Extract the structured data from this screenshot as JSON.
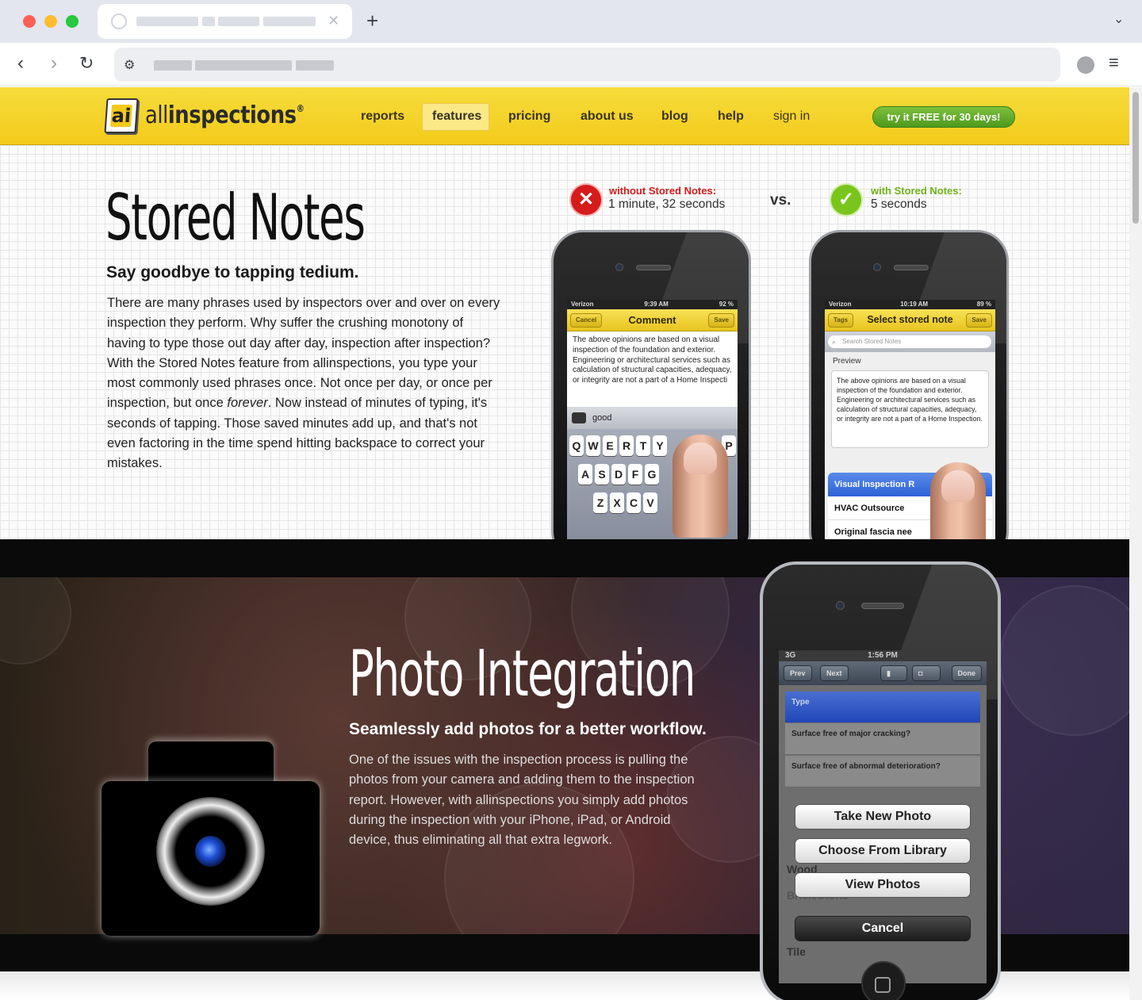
{
  "site": {
    "logo": {
      "mark": "ai",
      "light": "all",
      "bold": "inspections",
      "reg": "®"
    },
    "nav": [
      {
        "label": "reports"
      },
      {
        "label": "features"
      },
      {
        "label": "pricing"
      },
      {
        "label": "about us"
      },
      {
        "label": "blog"
      },
      {
        "label": "help"
      },
      {
        "label": "sign in"
      }
    ],
    "active_nav": "features",
    "cta": "try it FREE for 30 days!"
  },
  "stored_notes": {
    "title": "Stored Notes",
    "subtitle": "Say goodbye to tapping tedium.",
    "body_before": "There are many phrases used by inspectors over and over on every inspection they perform. Why suffer the crushing monotony of having to type those out day after day, inspection after inspection? With the Stored Notes feature from allinspections, you type your most commonly used phrases once. Not once per day, or once per inspection, but once ",
    "body_em": "forever",
    "body_after": ".  Now instead of minutes of typing, it's seconds of tapping. Those saved minutes add up, and that's not even factoring in the time spend hitting backspace to correct your mistakes.",
    "without_label": "without Stored Notes:",
    "without_time": "1 minute, 32 seconds",
    "vs": "vs.",
    "with_label": "with Stored Notes:",
    "with_time": "5 seconds",
    "phone_left": {
      "carrier": "Verizon",
      "time": "9:39 AM",
      "battery": "92 %",
      "cancel": "Cancel",
      "title": "Comment",
      "save": "Save",
      "text": "The above opinions are based on a visual inspection of the foundation and exterior. Engineering or architectural services such as calculation of structural capacities, adequacy, or integrity are not a part of a Home Inspecti",
      "suggestion": "good",
      "kb_row1": [
        "Q",
        "W",
        "E",
        "R",
        "T",
        "Y",
        "",
        "",
        "",
        "P"
      ],
      "kb_row2": [
        "A",
        "S",
        "D",
        "F",
        "G"
      ],
      "kb_row3": [
        "Z",
        "X",
        "C",
        "V"
      ]
    },
    "phone_right": {
      "carrier": "Verizon",
      "time": "10:19 AM",
      "battery": "89 %",
      "tags": "Tags",
      "title": "Select stored note",
      "save": "Save",
      "search_placeholder": "Search Stored Notes",
      "preview_label": "Preview",
      "preview_text": "The above opinions are based on a visual inspection of the foundation and exterior. Engineering or architectural services such as calculation of structural capacities, adequacy, or integrity are not a part of a Home Inspection.",
      "items": [
        "Visual Inspection R",
        "HVAC Outsource",
        "Original fascia nee"
      ]
    }
  },
  "photo_integration": {
    "title": "Photo Integration",
    "subtitle": "Seamlessly add photos for a better workflow.",
    "body": "One of the issues with the inspection process is pulling the photos from your camera and adding them to the inspection report. However, with allinspections you simply add photos during the inspection with your iPhone, iPad, or Android device, thus eliminating all that extra legwork.",
    "phone": {
      "network": "3G",
      "time": "1:56 PM",
      "prev": "Prev",
      "next": "Next",
      "done": "Done",
      "row_selected": "Type",
      "row1": "Surface free of major cracking?",
      "row2": "Surface free of abnormal deterioration?",
      "actions": [
        "Take New Photo",
        "Choose From Library",
        "View Photos"
      ],
      "cancel": "Cancel",
      "behind": [
        "Wood",
        "Brick/Stone",
        "Tile"
      ]
    }
  },
  "colors": {
    "header_yellow": "#f4d22a",
    "cta_green": "#5ea828",
    "bad_red": "#d61b1b",
    "good_green": "#7ac51b"
  }
}
